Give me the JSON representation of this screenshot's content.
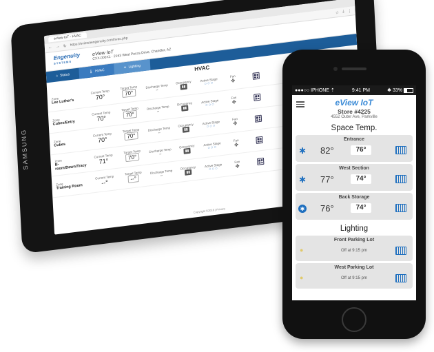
{
  "tablet": {
    "brand": "SAMSUNG",
    "browser_tab": "eView IoT - HVAC",
    "url": "https://eviewaengenuity.com/hvac.php",
    "logo_main": "Engenuity",
    "logo_sub": "SYSTEMS",
    "header_title": "eView IoT",
    "header_address": "CXX-000X1 · 2163 West Pecos Drive, Chandler, AZ",
    "nav": [
      {
        "label": "Status"
      },
      {
        "label": "HVAC"
      },
      {
        "label": "Lighting"
      }
    ],
    "page_title": "HVAC",
    "col_labels": {
      "zone": "Zone",
      "current": "Current Temp",
      "target": "Target Temp",
      "discharge": "Discharge Temp",
      "occupancy": "Occupancy",
      "active": "Active Stage",
      "fan": "Fan"
    },
    "zones": [
      {
        "name": "Lee Luther's",
        "current": "70°",
        "target": "70°",
        "discharge": "--"
      },
      {
        "name": "Cubes/Entry",
        "current": "70°",
        "target": "70°",
        "discharge": "--"
      },
      {
        "name": "Cubes",
        "current": "70°",
        "target": "70°",
        "discharge": "--"
      },
      {
        "name": "B-room/Dawn/Tracy",
        "current": "71°",
        "target": "70°",
        "discharge": "--"
      },
      {
        "name": "Training Room",
        "current": "--°",
        "target": "--°",
        "discharge": "--"
      }
    ],
    "footer": "Copyright ©2018 | Privacy"
  },
  "phone": {
    "status": {
      "carrier": "●●●○○ IPHONE ⇡",
      "time": "9:41 PM",
      "battery": "33%"
    },
    "brand": "eView IoT",
    "store": "Store #4225",
    "address": "4552 Outer Ave, Parkville",
    "space_title": "Space Temp.",
    "spaces": [
      {
        "name": "Entrance",
        "current": "82°",
        "target": "76°",
        "icon": "snowflake-icon"
      },
      {
        "name": "West Section",
        "current": "77°",
        "target": "74°",
        "icon": "snowflake-icon"
      },
      {
        "name": "Back Storage",
        "current": "76°",
        "target": "74°",
        "icon": "snowflake-circle-icon"
      }
    ],
    "lighting_title": "Lighting",
    "lights": [
      {
        "name": "Front Parking Lot",
        "status": "Off at 9:15 pm"
      },
      {
        "name": "West Parking Lot",
        "status": "Off at 9:15 pm"
      }
    ]
  },
  "colors": {
    "accent": "#3a8ad6",
    "nav": "#1d5d99",
    "snow": "#1e6fbf"
  }
}
